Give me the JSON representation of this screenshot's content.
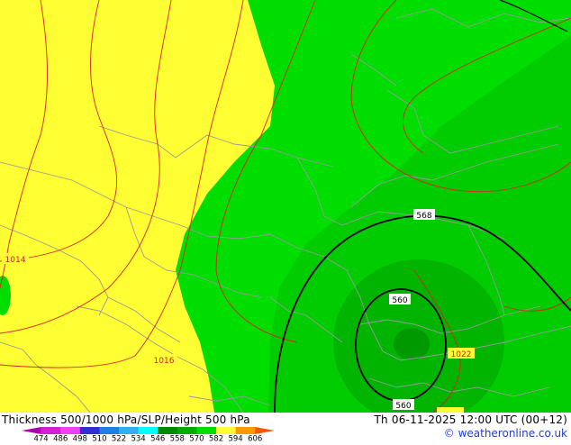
{
  "footer": {
    "title": "Thickness 500/1000 hPa/SLP/Height 500 hPa",
    "datetime": "Th 06-11-2025 12:00 UTC (00+12)",
    "credit": "© weatheronline.co.uk"
  },
  "legend": {
    "values": [
      "474",
      "486",
      "498",
      "510",
      "522",
      "534",
      "546",
      "558",
      "570",
      "582",
      "594",
      "606"
    ],
    "colors": [
      "#b000b0",
      "#d020d0",
      "#f040f0",
      "#3030d0",
      "#2080e0",
      "#30b0f0",
      "#00ffff",
      "#008800",
      "#00aa00",
      "#00dd00",
      "#ffff33",
      "#ff9900",
      "#ff5500"
    ]
  },
  "map": {
    "height_labels": [
      "568",
      "560",
      "560"
    ],
    "pressure_labels": [
      "1014",
      "1016",
      "1022"
    ],
    "colors": {
      "yellow": "#ffff33",
      "green_bright": "#00dd00",
      "green_mid": "#00bb00",
      "green_dark": "#009900",
      "isobar": "#dd2222",
      "height_contour": "#000000",
      "border": "#9a9a9a"
    }
  }
}
